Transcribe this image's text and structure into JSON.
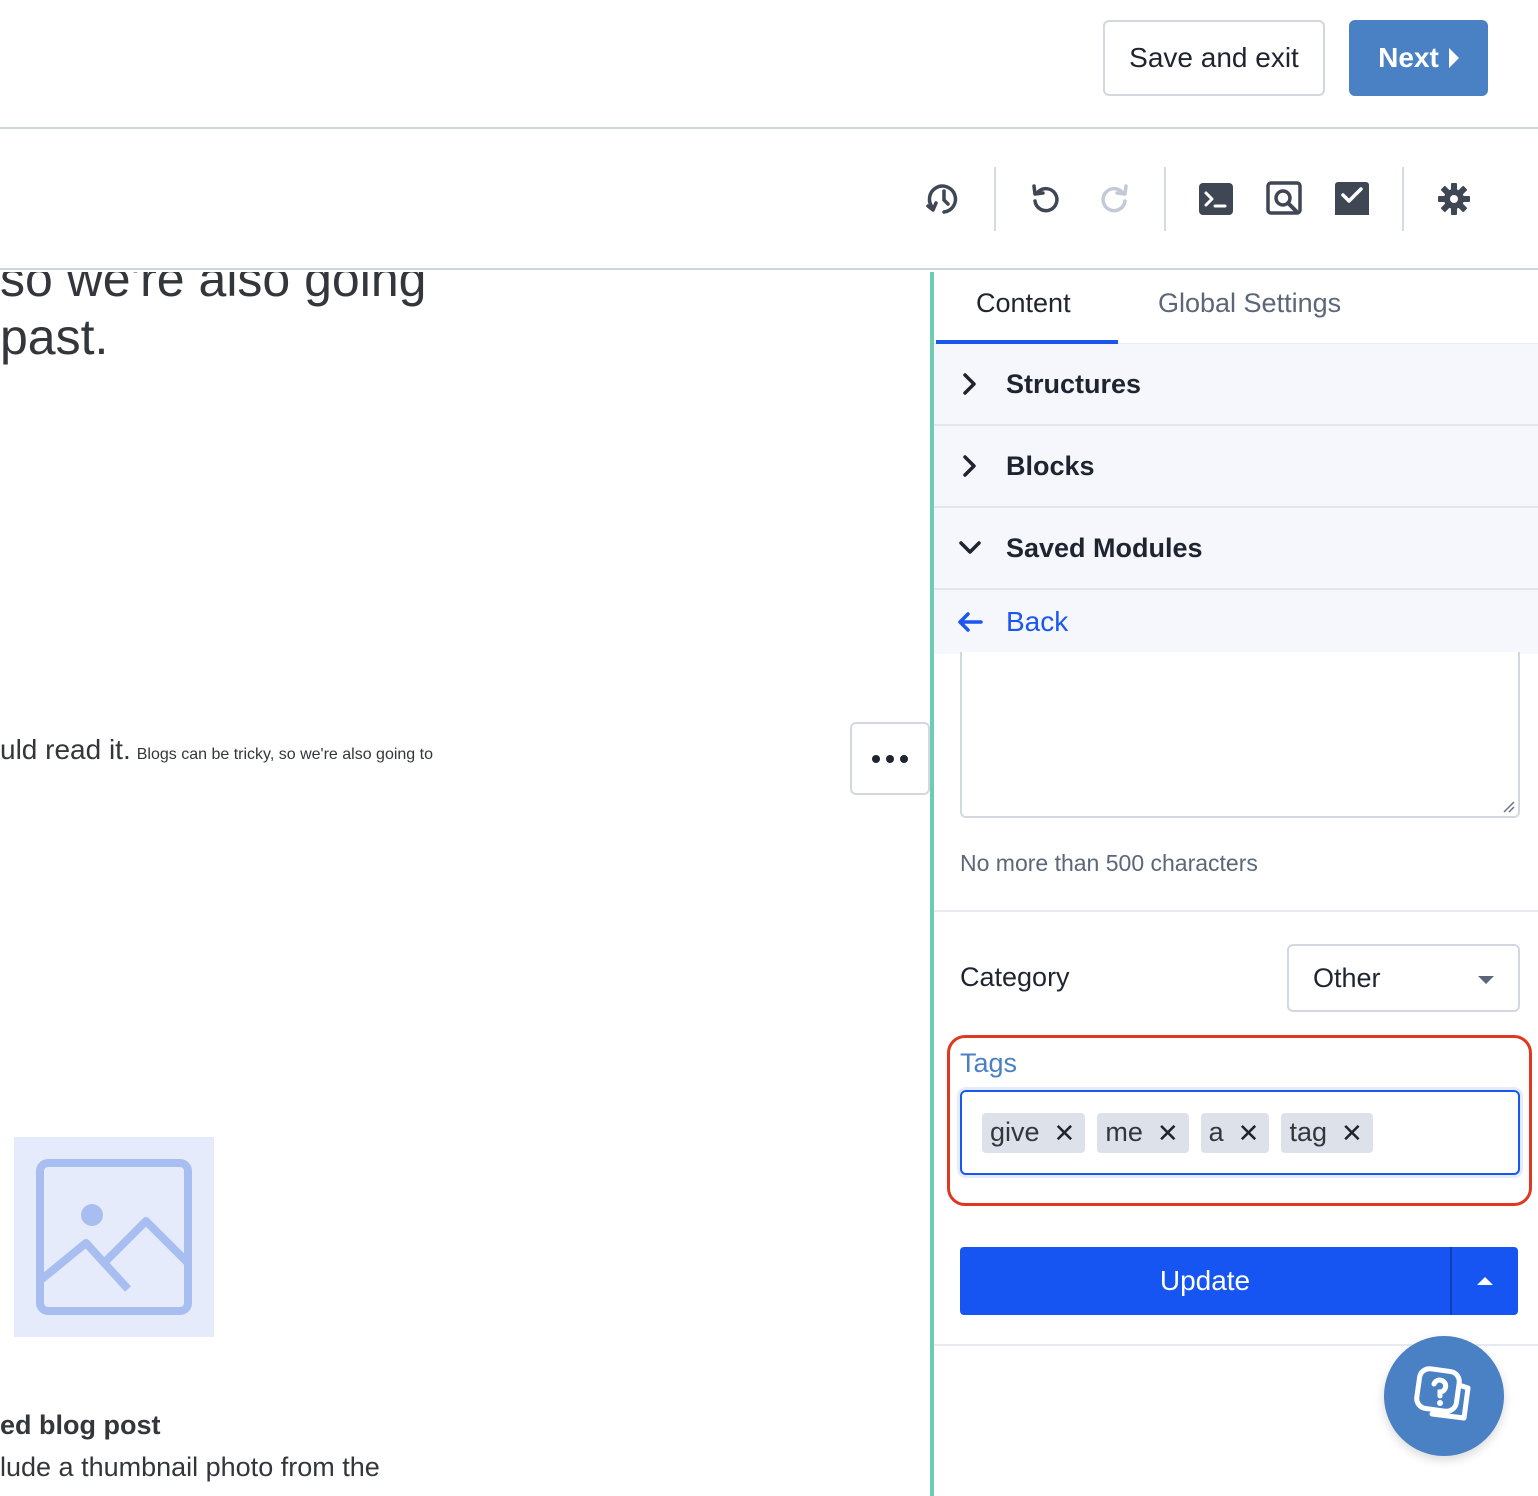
{
  "header": {
    "save_exit_label": "Save and exit",
    "next_label": "Next"
  },
  "toolbar": {
    "icons": [
      "history-icon",
      "undo-icon",
      "redo-icon",
      "terminal-icon",
      "preview-icon",
      "check-icon",
      "gear-icon"
    ]
  },
  "canvas": {
    "heading_line1": "so we're also going",
    "heading_line2": "past.",
    "para_large": "uld read it.",
    "para_small": "Blogs can be tricky, so we're also going to",
    "post_title": "ed blog post",
    "post_desc": "lude a thumbnail photo from the"
  },
  "panel": {
    "tabs": [
      {
        "label": "Content",
        "active": true
      },
      {
        "label": "Global Settings",
        "active": false
      }
    ],
    "accordion": [
      {
        "label": "Structures",
        "expanded": false
      },
      {
        "label": "Blocks",
        "expanded": false
      },
      {
        "label": "Saved Modules",
        "expanded": true
      }
    ],
    "back_label": "Back",
    "description_hint": "No more than 500 characters",
    "category_label": "Category",
    "category_value": "Other",
    "tags_label": "Tags",
    "tags": [
      "give",
      "me",
      "a",
      "tag"
    ],
    "update_label": "Update"
  },
  "colors": {
    "accent": "#1655f1",
    "next_button": "#4a80c4",
    "divider": "#6dcdb4",
    "highlight": "#e0371f"
  }
}
